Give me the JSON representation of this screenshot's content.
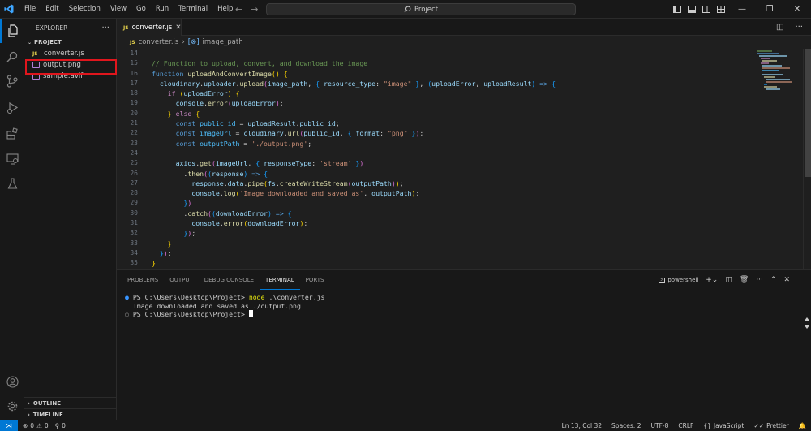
{
  "titlebar": {
    "menu": [
      "File",
      "Edit",
      "Selection",
      "View",
      "Go",
      "Run",
      "Terminal",
      "Help"
    ],
    "search_text": "Project"
  },
  "sidebar": {
    "title": "EXPLORER",
    "project_label": "PROJECT",
    "files": [
      {
        "name": "converter.js",
        "type": "js"
      },
      {
        "name": "output.png",
        "type": "image"
      },
      {
        "name": "sample.avif",
        "type": "image"
      }
    ],
    "outline_label": "OUTLINE",
    "timeline_label": "TIMELINE"
  },
  "editor": {
    "tab_label": "converter.js",
    "tab_icon": "JS",
    "breadcrumb_file": "converter.js",
    "breadcrumb_symbol": "image_path",
    "line_numbers": [
      "14",
      "15",
      "16",
      "17",
      "18",
      "19",
      "20",
      "21",
      "22",
      "23",
      "24",
      "25",
      "26",
      "27",
      "28",
      "29",
      "30",
      "31",
      "32",
      "33",
      "34",
      "35",
      "36"
    ]
  },
  "panel": {
    "tabs": [
      "PROBLEMS",
      "OUTPUT",
      "DEBUG CONSOLE",
      "TERMINAL",
      "PORTS"
    ],
    "active_tab": "TERMINAL",
    "shell_label": "powershell",
    "terminal_lines": [
      {
        "prompt": "PS C:\\Users\\Desktop\\Project> ",
        "cmd": "node",
        "args": " .\\converter.js"
      },
      {
        "output": "Image downloaded and saved as ./output.png"
      },
      {
        "prompt": "PS C:\\Users\\Desktop\\Project> "
      }
    ]
  },
  "statusbar": {
    "errors": "0",
    "warnings": "0",
    "ports": "0",
    "position": "Ln 13, Col 32",
    "spaces": "Spaces: 2",
    "encoding": "UTF-8",
    "eol": "CRLF",
    "language": "JavaScript",
    "formatter": "Prettier"
  },
  "colors": {
    "accent": "#0078d4",
    "highlight_box": "#e0161d"
  }
}
